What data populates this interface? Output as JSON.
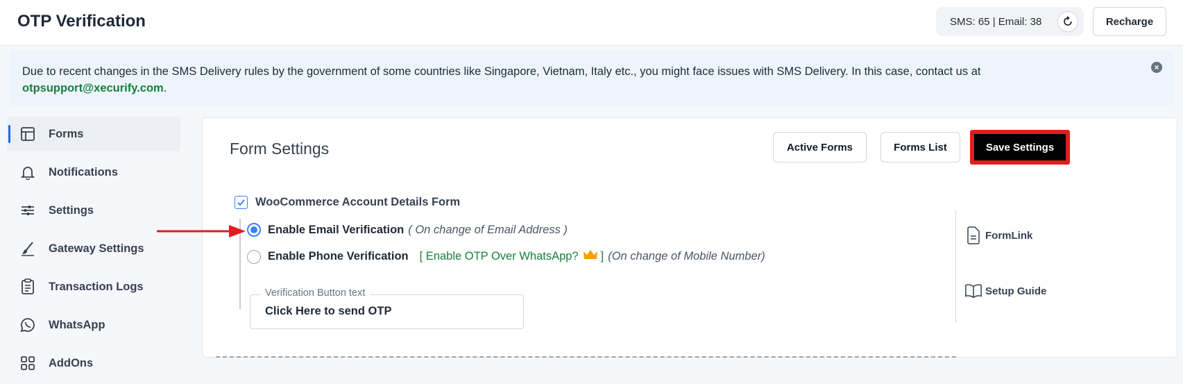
{
  "header": {
    "title": "OTP Verification",
    "credits": "SMS: 65 | Email: 38",
    "recharge_label": "Recharge"
  },
  "notice": {
    "text": "Due to recent changes in the SMS Delivery rules by the government of some countries like Singapore, Vietnam, Italy etc., you might face issues with SMS Delivery. In this case, contact us at",
    "email": "otpsupport@xecurify.com",
    "suffix": "."
  },
  "sidebar": {
    "items": [
      {
        "label": "Forms",
        "icon": "layout-icon",
        "active": true
      },
      {
        "label": "Notifications",
        "icon": "bell-icon"
      },
      {
        "label": "Settings",
        "icon": "sliders-icon"
      },
      {
        "label": "Gateway Settings",
        "icon": "brush-icon"
      },
      {
        "label": "Transaction Logs",
        "icon": "clipboard-icon"
      },
      {
        "label": "WhatsApp",
        "icon": "whatsapp-icon"
      },
      {
        "label": "AddOns",
        "icon": "grid-icon"
      }
    ]
  },
  "panel": {
    "title": "Form Settings",
    "active_forms_label": "Active Forms",
    "forms_list_label": "Forms List",
    "save_label": "Save Settings",
    "form_name": "WooCommerce Account Details Form",
    "email_option": {
      "label": "Enable Email Verification",
      "hint": "( On change of Email Address )",
      "selected": true
    },
    "phone_option": {
      "label": "Enable Phone Verification",
      "whatsapp_link": "[ Enable OTP Over WhatsApp?",
      "whatsapp_close": "]",
      "hint": "(On change of Mobile Number)",
      "selected": false
    },
    "button_text_legend": "Verification Button text",
    "button_text_value": "Click Here to send OTP",
    "formlink_label": "FormLink",
    "setup_guide_label": "Setup Guide"
  },
  "colors": {
    "accent": "#3b82f6",
    "annotation": "#e11d1d",
    "link_green": "#15803d"
  }
}
